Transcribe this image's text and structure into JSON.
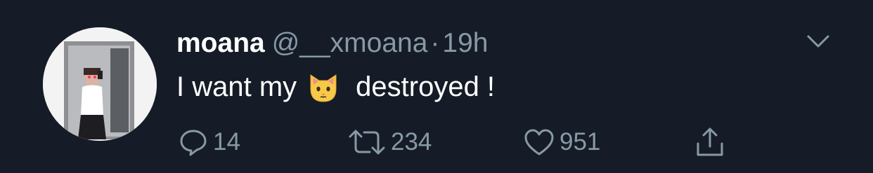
{
  "tweet": {
    "name": "moana",
    "handle": "@__xmoana",
    "separator": "·",
    "time": "19h",
    "text_before": "I want my",
    "emoji": "cat-face-emoji",
    "text_after": "destroyed !"
  },
  "actions": {
    "reply_count": "14",
    "retweet_count": "234",
    "like_count": "951"
  },
  "colors": {
    "background": "#151c27",
    "primary_text": "#ffffff",
    "secondary_text": "#8899a6"
  }
}
